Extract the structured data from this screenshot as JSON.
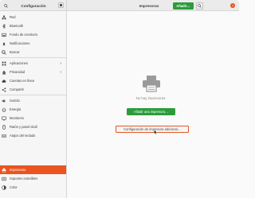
{
  "sidebar": {
    "title": "Configuración",
    "items": [
      {
        "label": "Red",
        "icon": "network-icon"
      },
      {
        "label": "Bluetooth",
        "icon": "bluetooth-icon"
      },
      {
        "label": "Fondo de escritorio",
        "icon": "background-icon"
      },
      {
        "label": "Notificaciones",
        "icon": "bell-icon"
      },
      {
        "label": "Buscar",
        "icon": "search-icon"
      },
      {
        "label": "Aplicaciones",
        "icon": "apps-icon",
        "arrow": "›"
      },
      {
        "label": "Privacidad",
        "icon": "hand-icon",
        "arrow": "›"
      },
      {
        "label": "Cuentas en línea",
        "icon": "cloud-icon"
      },
      {
        "label": "Compartir",
        "icon": "share-icon"
      },
      {
        "label": "Sonido",
        "icon": "speaker-icon"
      },
      {
        "label": "Energía",
        "icon": "power-icon"
      },
      {
        "label": "Monitores",
        "icon": "monitor-icon"
      },
      {
        "label": "Ratón y panel táctil",
        "icon": "mouse-icon"
      },
      {
        "label": "Atajos del teclado",
        "icon": "keyboard-icon"
      },
      {
        "label": "Impresoras",
        "icon": "printer-icon",
        "selected": true
      },
      {
        "label": "Soportes extraíbles",
        "icon": "media-icon"
      },
      {
        "label": "Color",
        "icon": "color-icon"
      }
    ]
  },
  "header": {
    "title": "Impresoras",
    "add_button": "Añadir…"
  },
  "main": {
    "empty_text": "No hay impresoras",
    "add_printer_button": "Añadir una impresora…",
    "additional_config_button": "Configuración de impresora adicional…"
  },
  "colors": {
    "accent": "#e95420",
    "success": "#2c9c3b"
  }
}
